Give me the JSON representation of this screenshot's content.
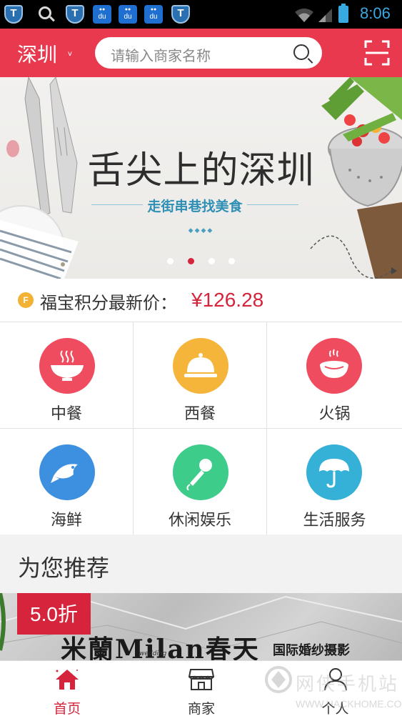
{
  "status_bar": {
    "time": "8:06",
    "notification_icons": [
      "shield-icon",
      "search-icon",
      "shield-icon",
      "baidu-paw-icon",
      "baidu-paw-icon",
      "baidu-paw-icon",
      "shield-icon"
    ]
  },
  "header": {
    "city": "深圳",
    "city_caret": "v",
    "search_placeholder": "请输入商家名称",
    "accent_color": "#e8394f"
  },
  "banner": {
    "title": "舌尖上的深圳",
    "subtitle": "走街串巷找美食",
    "slide_count": 4,
    "active_slide": 2
  },
  "points": {
    "badge": "F",
    "label": "福宝积分最新价：",
    "value": "¥126.28"
  },
  "categories": [
    {
      "label": "中餐",
      "icon": "chinese-food-bowl-icon",
      "color": "#ef4d5f"
    },
    {
      "label": "西餐",
      "icon": "cloche-icon",
      "color": "#f5b53b"
    },
    {
      "label": "火锅",
      "icon": "hotpot-icon",
      "color": "#ef4d5f"
    },
    {
      "label": "海鲜",
      "icon": "fish-icon",
      "color": "#3d8fe0"
    },
    {
      "label": "休闲娱乐",
      "icon": "microphone-icon",
      "color": "#3dcc8a"
    },
    {
      "label": "生活服务",
      "icon": "umbrella-icon",
      "color": "#35b1d8"
    }
  ],
  "recommend": {
    "title": "为您推荐",
    "items": [
      {
        "discount": "5.0折",
        "name_text": "米蘭Milan春天",
        "name_small": "wedding",
        "subtitle": "国际婚纱摄影"
      }
    ]
  },
  "tabbar": {
    "tabs": [
      {
        "label": "首页",
        "icon": "home-icon",
        "active": true
      },
      {
        "label": "商家",
        "icon": "store-icon",
        "active": false
      },
      {
        "label": "个人",
        "icon": "person-icon",
        "active": false
      }
    ]
  },
  "watermark": {
    "text": "网侠手机站",
    "url": "WWW.HACKHOME.COM"
  }
}
